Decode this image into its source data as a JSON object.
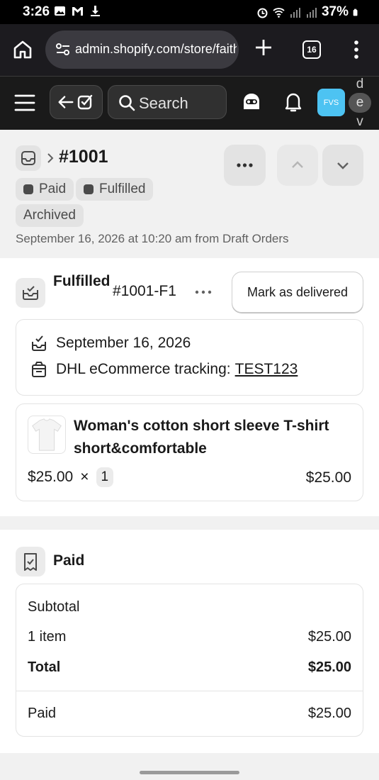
{
  "status_bar": {
    "time": "3:26",
    "battery": "37%"
  },
  "browser": {
    "url": "admin.shopify.com/store/faith",
    "tab_count": "16"
  },
  "admin_topbar": {
    "search_label": "Search",
    "avatar_initials": "FVS",
    "dev_letters": [
      "d",
      "e",
      "v"
    ],
    "avatar_color": "#4dc3f2"
  },
  "order": {
    "number": "#1001",
    "badges": [
      {
        "label": "Paid",
        "has_dot": true
      },
      {
        "label": "Fulfilled",
        "has_dot": true
      },
      {
        "label": "Archived",
        "has_dot": false
      }
    ],
    "meta": "September 16, 2026 at 10:20 am from Draft Orders"
  },
  "fulfillment": {
    "title": "Fulfilled",
    "fulfillment_id": "#1001-F1",
    "mark_delivered_label": "Mark as delivered",
    "date": "September 16, 2026",
    "tracking_label": "DHL eCommerce tracking:",
    "tracking_number": "TEST123",
    "item": {
      "name": "Woman's cotton short sleeve T-shirt short&comfortable",
      "unit_price": "$25.00",
      "times": "×",
      "quantity": "1",
      "total": "$25.00"
    }
  },
  "payment": {
    "title": "Paid",
    "subtotal_label": "Subtotal",
    "items_label": "1 item",
    "items_value": "$25.00",
    "total_label": "Total",
    "total_value": "$25.00",
    "paid_label": "Paid",
    "paid_value": "$25.00"
  }
}
